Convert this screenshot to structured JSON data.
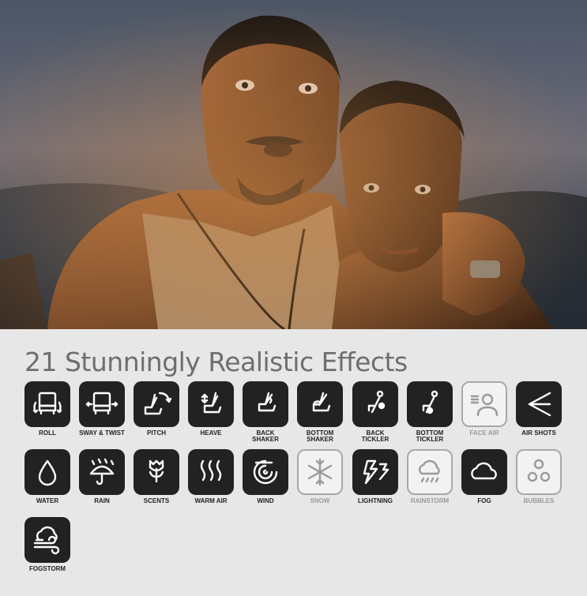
{
  "page": {
    "background": "#e7e7e7"
  },
  "hero": {
    "image": "movie-still-two-men"
  },
  "section": {
    "title": "21 Stunningly Realistic Effects"
  },
  "colors": {
    "tile_active": "#222222",
    "tile_inactive": "#f2f2f2",
    "label_active": "#222222",
    "label_inactive": "#9a9a9a"
  },
  "effects": [
    {
      "label": "ROLL",
      "icon": "roll-seat-icon",
      "active": true
    },
    {
      "label": "SWAY & TWIST",
      "icon": "sway-twist-seat-icon",
      "active": true
    },
    {
      "label": "PITCH",
      "icon": "pitch-seat-icon",
      "active": true
    },
    {
      "label": "HEAVE",
      "icon": "heave-seat-icon",
      "active": true
    },
    {
      "label": "BACK\nSHAKER",
      "icon": "back-shaker-seat-icon",
      "active": true
    },
    {
      "label": "BOTTOM\nSHAKER",
      "icon": "bottom-shaker-seat-icon",
      "active": true
    },
    {
      "label": "BACK\nTICKLER",
      "icon": "back-tickler-icon",
      "active": true
    },
    {
      "label": "BOTTOM\nTICKLER",
      "icon": "bottom-tickler-icon",
      "active": true
    },
    {
      "label": "FACE AIR",
      "icon": "face-air-icon",
      "active": false
    },
    {
      "label": "AIR SHOTS",
      "icon": "air-shots-icon",
      "active": true
    },
    {
      "label": "WATER",
      "icon": "water-drop-icon",
      "active": true
    },
    {
      "label": "RAIN",
      "icon": "rain-umbrella-icon",
      "active": true
    },
    {
      "label": "SCENTS",
      "icon": "scents-flower-icon",
      "active": true
    },
    {
      "label": "WARM AIR",
      "icon": "warm-air-icon",
      "active": true
    },
    {
      "label": "WIND",
      "icon": "wind-swirl-icon",
      "active": true
    },
    {
      "label": "SNOW",
      "icon": "snowflake-icon",
      "active": false
    },
    {
      "label": "LIGHTNING",
      "icon": "lightning-icon",
      "active": true
    },
    {
      "label": "RAINSTORM",
      "icon": "rainstorm-cloud-icon",
      "active": false
    },
    {
      "label": "FOG",
      "icon": "fog-cloud-icon",
      "active": true
    },
    {
      "label": "BUBBLES",
      "icon": "bubbles-icon",
      "active": false
    },
    {
      "label": "FOGSTORM",
      "icon": "fogstorm-icon",
      "active": true
    }
  ]
}
